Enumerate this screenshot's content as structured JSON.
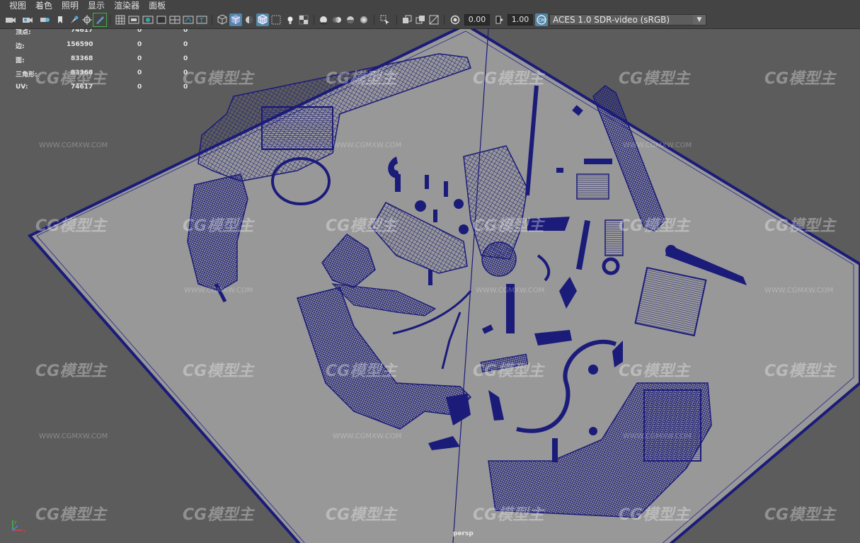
{
  "menu": [
    "视图",
    "着色",
    "照明",
    "显示",
    "渲染器",
    "面板"
  ],
  "toolbar": {
    "exposure_value": "0.00",
    "gamma_value": "1.00",
    "color_space": "ACES 1.0 SDR-video (sRGB)",
    "icons": [
      "camera-select-icon",
      "camera-attributes-icon",
      "bookmark-icon",
      "image-plane-icon",
      "2d-pan-zoom-icon",
      "grease-pencil-icon",
      "grid-icon",
      "film-gate-icon",
      "resolution-gate-icon",
      "gate-mask-icon",
      "field-chart-icon",
      "safe-action-icon",
      "safe-title-icon",
      "wireframe-icon",
      "smooth-shade-icon",
      "default-material-icon",
      "wireframe-on-shaded-icon",
      "xray-icon",
      "use-lights-icon",
      "shadows-icon",
      "screen-space-ao-icon",
      "motion-blur-icon",
      "anti-alias-icon",
      "depth-of-field-icon",
      "isolate-select-icon",
      "xray-joints-icon",
      "xray-active-icon",
      "backface-icon",
      "exposure-icon",
      "gamma-icon",
      "color-management-icon"
    ]
  },
  "hud": {
    "rows": [
      {
        "label": "顶点:",
        "a": "74617",
        "b": "0",
        "c": "0"
      },
      {
        "label": "边:",
        "a": "156590",
        "b": "0",
        "c": "0"
      },
      {
        "label": "面:",
        "a": "83368",
        "b": "0",
        "c": "0"
      },
      {
        "label": "三角形:",
        "a": "83368",
        "b": "0",
        "c": "0"
      },
      {
        "label": "UV:",
        "a": "74617",
        "b": "0",
        "c": "0"
      }
    ]
  },
  "camera_label": "persp",
  "watermark": {
    "logo": "CG模型主",
    "url": "WWW.CGMXW.COM"
  },
  "colors": {
    "wire": "#1b1b7a",
    "plane": "#979797",
    "bg": "#5c5c5c",
    "ui": "#444444",
    "accent": "#5285a6"
  }
}
